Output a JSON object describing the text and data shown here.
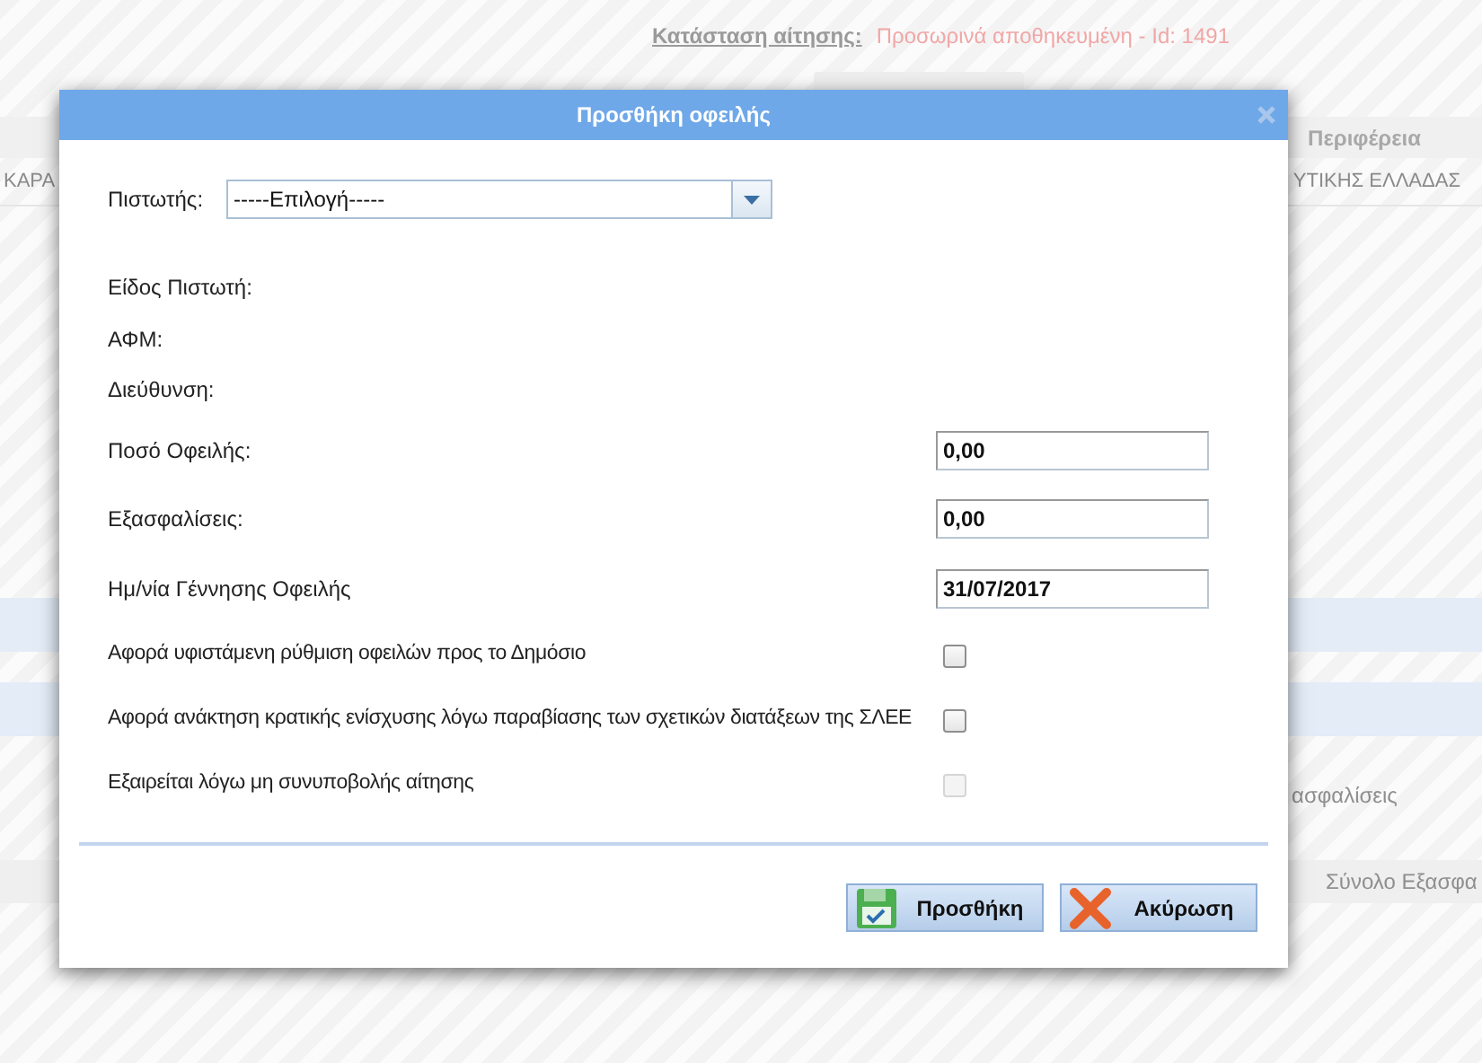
{
  "background": {
    "status_label": "Κατάσταση αίτησης:",
    "status_value": "Προσωρινά αποθηκευμένη - Id: 1491",
    "table_header": "Περιφέρεια",
    "row_cells": [
      "ΚΑΡΑ",
      "ΥΤΙΚΗΣ ΕΛΛΑΔΑΣ"
    ],
    "lower_labels": [
      "ασφαλίσεις",
      "Σύνολο Εξασφα"
    ]
  },
  "dialog": {
    "title": "Προσθήκη οφειλής",
    "fields": [
      {
        "kind": "select",
        "label": "Πιστωτής:",
        "value": "-----Επιλογή-----"
      },
      {
        "kind": "info",
        "label": "Είδος Πιστωτή:"
      },
      {
        "kind": "info",
        "label": "ΑΦΜ:"
      },
      {
        "kind": "info",
        "label": "Διεύθυνση:"
      },
      {
        "kind": "input",
        "label": "Ποσό Οφειλής:",
        "value": "0,00"
      },
      {
        "kind": "input",
        "label": "Εξασφαλίσεις:",
        "value": "0,00"
      },
      {
        "kind": "input",
        "label": "Ημ/νία Γέννησης Οφειλής",
        "value": "31/07/2017"
      },
      {
        "kind": "checkbox",
        "label": "Αφορά υφιστάμενη ρύθμιση οφειλών προς το Δημόσιο",
        "checked": false,
        "disabled": false
      },
      {
        "kind": "checkbox",
        "label": "Αφορά ανάκτηση κρατικής ενίσχυσης λόγω παραβίασης των σχετικών διατάξεων της ΣΛΕΕ",
        "checked": false,
        "disabled": false
      },
      {
        "kind": "checkbox",
        "label": "Εξαιρείται λόγω μη συνυποβολής αίτησης",
        "checked": false,
        "disabled": true
      }
    ],
    "buttons": [
      {
        "kind": "save",
        "label": "Προσθήκη"
      },
      {
        "kind": "cancel",
        "label": "Ακύρωση"
      }
    ]
  }
}
